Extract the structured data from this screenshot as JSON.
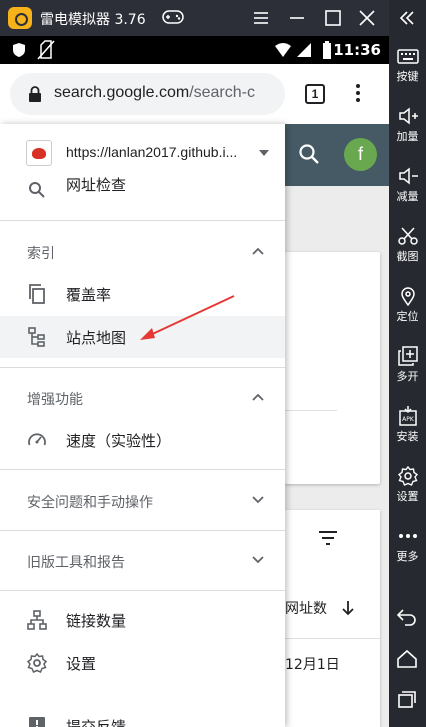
{
  "emulator": {
    "title": "雷电模拟器 3.76",
    "sidebar_items": [
      {
        "label": "按键",
        "icon": "keyboard-icon"
      },
      {
        "label": "加量",
        "icon": "volume-up-icon"
      },
      {
        "label": "减量",
        "icon": "volume-down-icon"
      },
      {
        "label": "截图",
        "icon": "scissors-icon"
      },
      {
        "label": "定位",
        "icon": "location-icon"
      },
      {
        "label": "多开",
        "icon": "multi-instance-icon"
      },
      {
        "label": "安装",
        "icon": "apk-install-icon"
      },
      {
        "label": "设置",
        "icon": "gear-icon"
      },
      {
        "label": "更多",
        "icon": "more-icon"
      }
    ]
  },
  "statusbar": {
    "time": "11:36"
  },
  "chrome": {
    "url_host": "search.google.com",
    "url_path": "/search-c",
    "tab_count": "1"
  },
  "page": {
    "avatar_letter": "f",
    "column_header": "内网址数",
    "cell_date": "12月1日"
  },
  "drawer": {
    "property": "https://lanlan2017.github.i...",
    "items": {
      "url_inspection": "网址检查",
      "index_section": "索引",
      "coverage": "覆盖率",
      "sitemaps": "站点地图",
      "enhancements_section": "增强功能",
      "speed": "速度（实验性）",
      "security_section": "安全问题和手动操作",
      "legacy_section": "旧版工具和报告",
      "links": "链接数量",
      "settings": "设置",
      "feedback": "提交反馈"
    }
  },
  "colors": {
    "header": "#455a64",
    "avatar": "#6aa84f",
    "annotation_arrow": "#e53935"
  }
}
